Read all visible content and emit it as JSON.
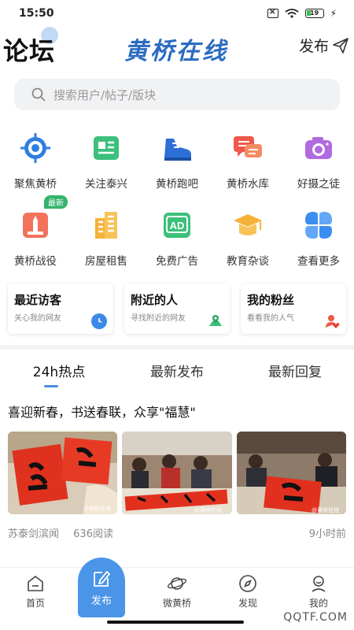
{
  "status_bar": {
    "time": "15:50",
    "battery": "19"
  },
  "header": {
    "title": "论坛",
    "brand": "黄桥在线",
    "publish_label": "发布"
  },
  "search": {
    "placeholder": "搜索用户/帖子/版块"
  },
  "grid": [
    {
      "label": "聚焦黄桥",
      "icon": "target-icon",
      "color": "#2e7fe0"
    },
    {
      "label": "关注泰兴",
      "icon": "newspaper-icon",
      "color": "#3cc07a"
    },
    {
      "label": "黄桥跑吧",
      "icon": "sneaker-icon",
      "color": "#2d6fd6"
    },
    {
      "label": "黄桥水库",
      "icon": "chat-bubbles-icon",
      "color": "#f0584a"
    },
    {
      "label": "好摄之徒",
      "icon": "camera-icon",
      "color": "#b06be0"
    },
    {
      "label": "黄桥战役",
      "icon": "monument-icon",
      "color": "#f3735a",
      "badge": "最新"
    },
    {
      "label": "房屋租售",
      "icon": "buildings-icon",
      "color": "#f6b13a"
    },
    {
      "label": "免费广告",
      "icon": "ad-icon",
      "color": "#3cc07a"
    },
    {
      "label": "教育杂谈",
      "icon": "graduation-cap-icon",
      "color": "#f6b13a"
    },
    {
      "label": "查看更多",
      "icon": "clover-icon",
      "color": "#3b8ef0"
    }
  ],
  "cards": [
    {
      "title": "最近访客",
      "subtitle": "关心我的网友",
      "icon": "clock-icon",
      "color": "#3d8ae6"
    },
    {
      "title": "附近的人",
      "subtitle": "寻找附近的网友",
      "icon": "location-icon",
      "color": "#3cc07a"
    },
    {
      "title": "我的粉丝",
      "subtitle": "看看我的人气",
      "icon": "heart-user-icon",
      "color": "#f0584a"
    }
  ],
  "tabs": [
    "24h热点",
    "最新发布",
    "最新回复"
  ],
  "post": {
    "title": "喜迎新春，书送春联，众享\"福慧\"",
    "author": "苏泰剑滨闻",
    "reads": "636阅读",
    "time": "9小时前",
    "image_watermark": "@黄桥在线"
  },
  "bottom_nav": [
    {
      "label": "首页",
      "icon": "home-icon"
    },
    {
      "label": "发布",
      "icon": "edit-icon"
    },
    {
      "label": "微黄桥",
      "icon": "planet-icon"
    },
    {
      "label": "发现",
      "icon": "compass-icon"
    },
    {
      "label": "我的",
      "icon": "user-icon"
    }
  ],
  "watermark": "QQTF.COM"
}
